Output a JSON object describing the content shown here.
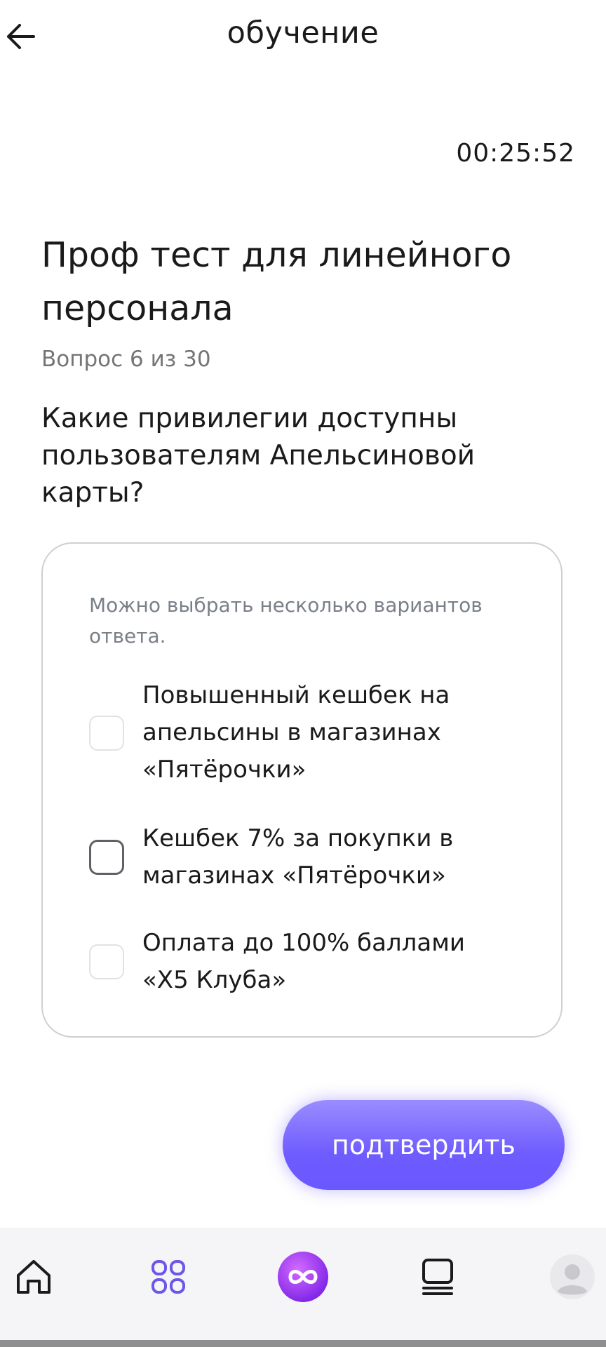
{
  "header": {
    "title": "обучение"
  },
  "timer": "00:25:52",
  "test": {
    "title": "Проф тест для линейного персонала",
    "counter": "Вопрос 6 из 30",
    "question": "Какие привилегии доступны пользователям Апельсиновой карты?"
  },
  "answers": {
    "hint": "Можно выбрать несколько вариантов ответа.",
    "options": [
      {
        "label": "Повышенный кешбек на апельсины в магазинах «Пятёрочки»",
        "checked": false
      },
      {
        "label": "Кешбек 7% за покупки в магазинах «Пятёрочки»",
        "checked": false
      },
      {
        "label": "Оплата до 100% баллами «Х5 Клуба»",
        "checked": false
      }
    ]
  },
  "confirm_button": "подтвердить",
  "colors": {
    "accent": "#6f5cff",
    "tab_active": "#6b57e8",
    "hint": "#7a7f88"
  },
  "tabbar": {
    "items": [
      {
        "icon": "home-icon"
      },
      {
        "icon": "grid-icon"
      },
      {
        "icon": "infinity-icon"
      },
      {
        "icon": "courses-icon"
      },
      {
        "icon": "avatar-icon"
      }
    ]
  }
}
